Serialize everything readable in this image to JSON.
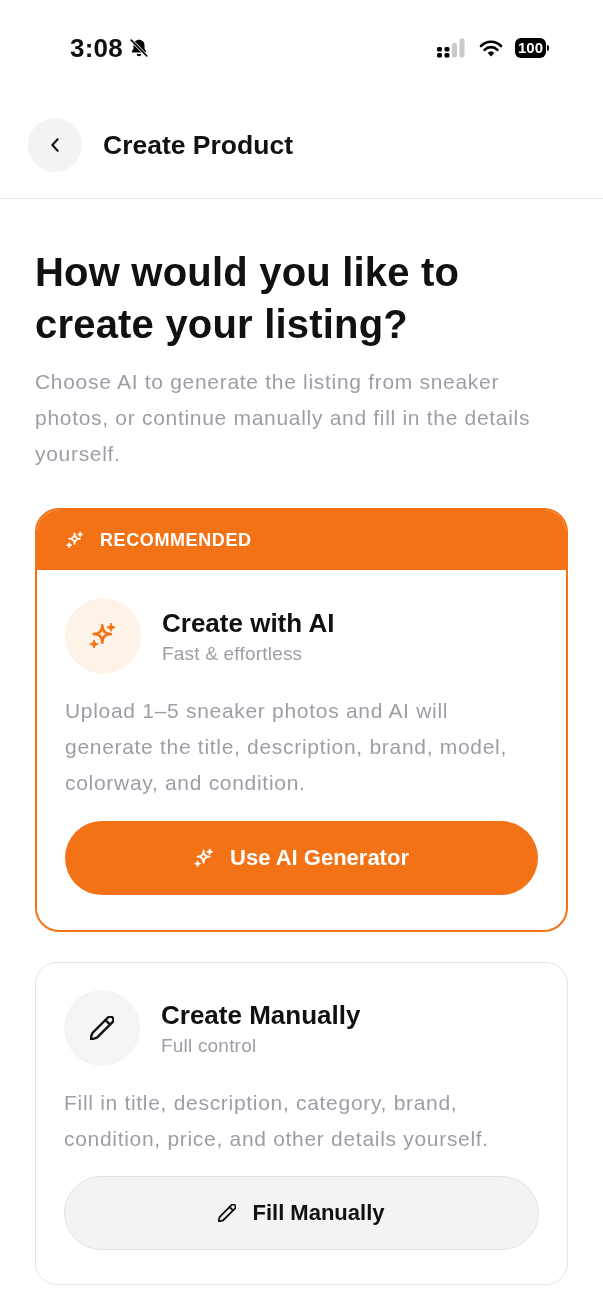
{
  "status_bar": {
    "time": "3:08",
    "battery": "100"
  },
  "header": {
    "title": "Create Product"
  },
  "intro": {
    "heading": "How would you like to create your listing?",
    "description": "Choose AI to generate the listing from sneaker photos, or continue manually and fill in the details yourself."
  },
  "options": [
    {
      "kind": "ai",
      "badge": "RECOMMENDED",
      "title": "Create with AI",
      "subtitle": "Fast & effortless",
      "description": "Upload 1–5 sneaker photos and AI will generate the title, description, brand, model, colorway, and condition.",
      "button": "Use AI Generator"
    },
    {
      "kind": "manual",
      "title": "Create Manually",
      "subtitle": "Full control",
      "description": "Fill in title, description, category, brand, condition, price, and other details yourself.",
      "button": "Fill Manually"
    }
  ]
}
